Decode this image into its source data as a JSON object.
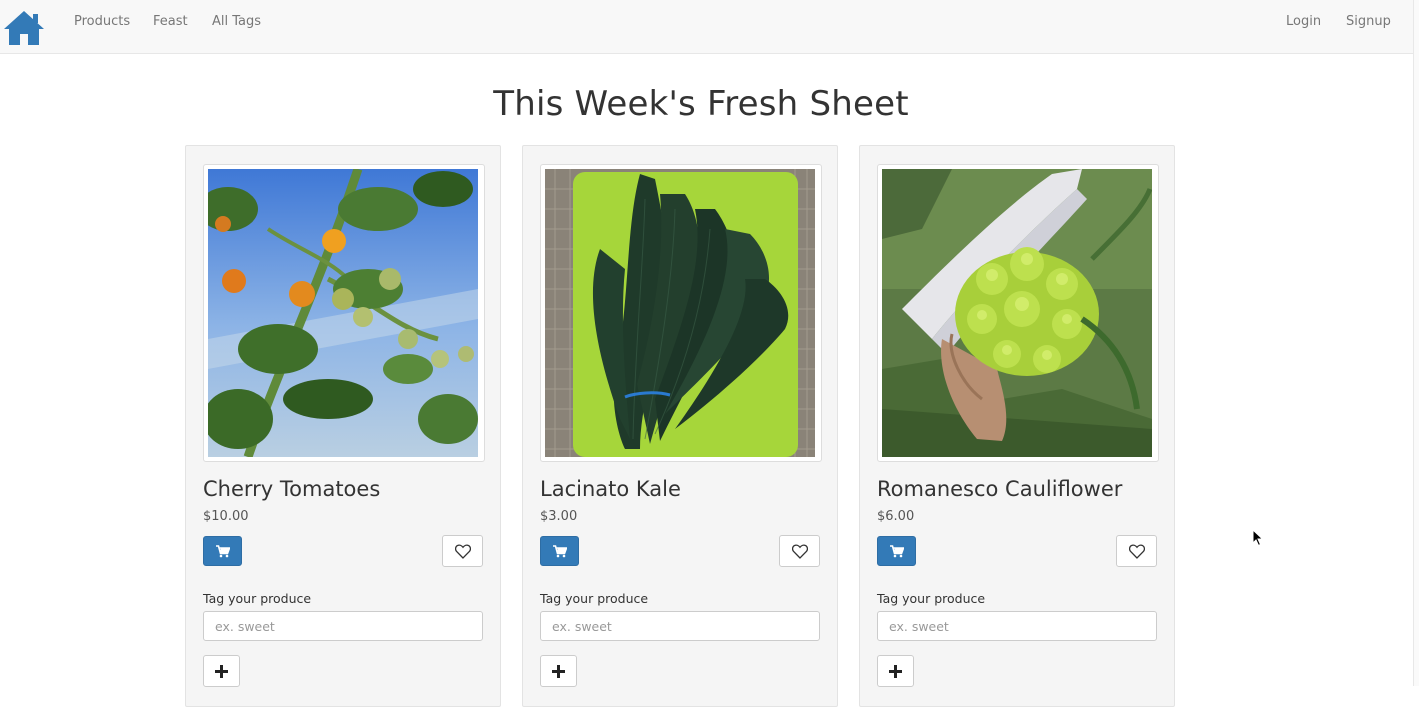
{
  "navbar": {
    "home_icon": "home-icon",
    "left_links": [
      "Products",
      "Feast",
      "All Tags"
    ],
    "right_links": [
      "Login",
      "Signup"
    ]
  },
  "page": {
    "title": "This Week's Fresh Sheet"
  },
  "products": [
    {
      "name": "Cherry Tomatoes",
      "price": "$10.00",
      "image": "cherry-tomatoes-photo",
      "tag_label": "Tag your produce",
      "tag_placeholder": "ex. sweet"
    },
    {
      "name": "Lacinato Kale",
      "price": "$3.00",
      "image": "lacinato-kale-photo",
      "tag_label": "Tag your produce",
      "tag_placeholder": "ex. sweet"
    },
    {
      "name": "Romanesco Cauliflower",
      "price": "$6.00",
      "image": "romanesco-cauliflower-photo",
      "tag_label": "Tag your produce",
      "tag_placeholder": "ex. sweet"
    }
  ],
  "icons": {
    "cart": "shopping-cart-icon",
    "favorite": "heart-icon",
    "add_tag": "plus-icon"
  },
  "colors": {
    "primary": "#337ab7",
    "navbar_bg": "#f8f8f8",
    "card_bg": "#f5f5f5"
  }
}
